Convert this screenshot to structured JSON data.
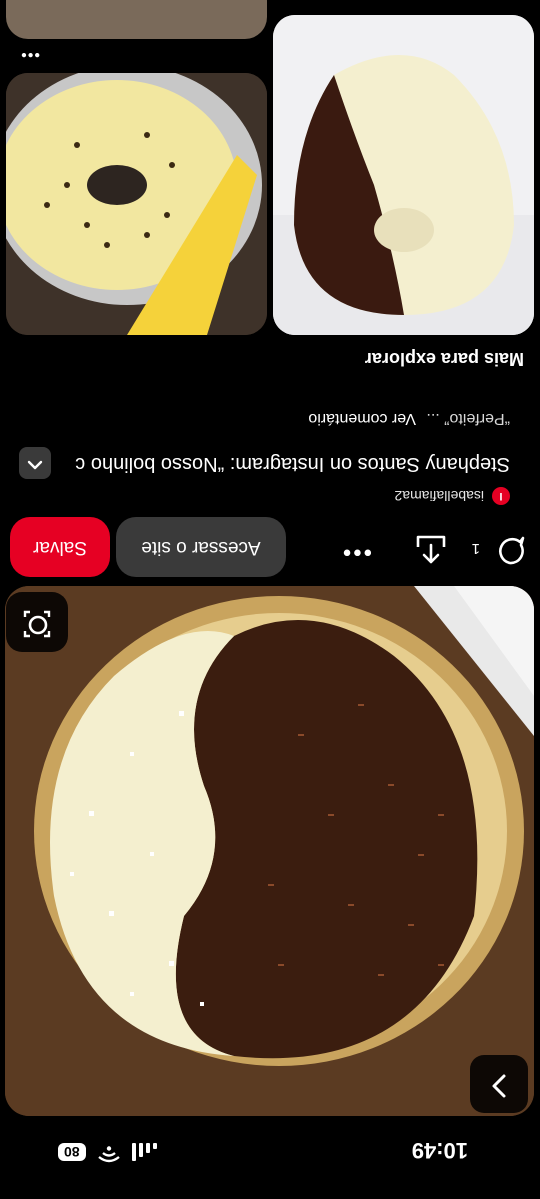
{
  "status_bar": {
    "time": "10:49",
    "battery": "80"
  },
  "pin": {
    "author": "isabellafiama2",
    "author_initial": "I",
    "title": "Stephany Santos on Instagram: “Nosso bolinho c",
    "description": "“Perfeito” ...",
    "more_comments": "Ver comentário",
    "comment_count": "1"
  },
  "actions": {
    "visit_label": "Acessar o site",
    "save_label": "Salvar",
    "more_label": "•••"
  },
  "explore": {
    "title": "Mais para explorar",
    "more_label": "•••"
  },
  "colors": {
    "save": "#e60023",
    "secondary_button": "#3a3a3a",
    "background": "#000000"
  },
  "icons": [
    "chevron-right-icon",
    "lens-icon",
    "comment-icon",
    "share-icon",
    "chevron-up-icon"
  ]
}
